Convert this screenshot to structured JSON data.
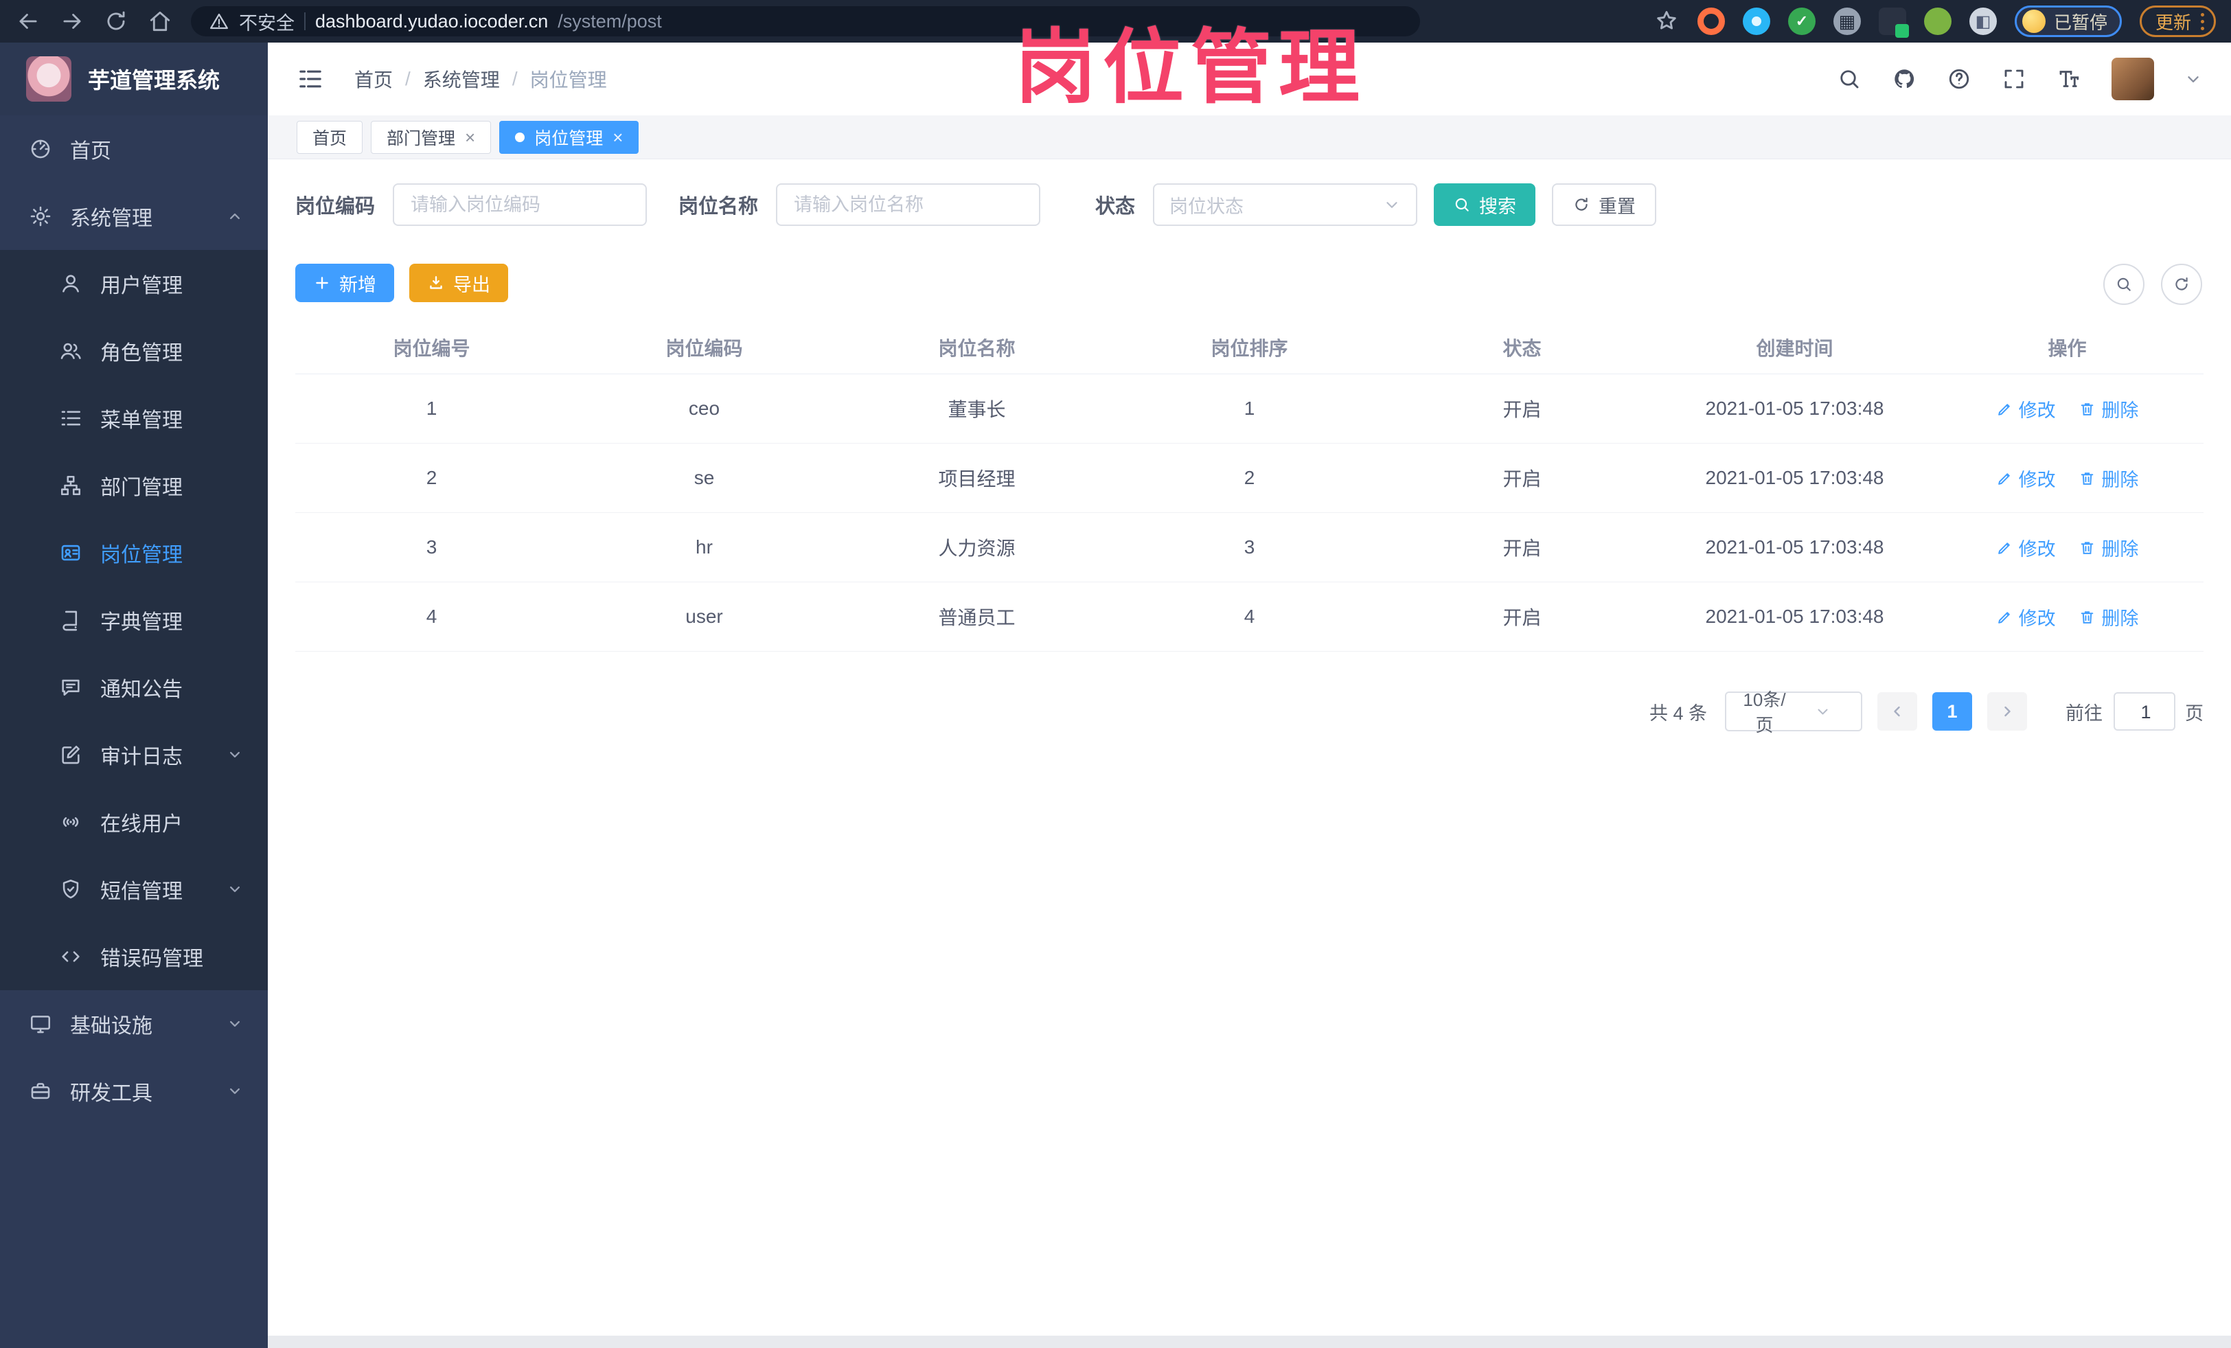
{
  "colors": {
    "accent": "#409eff",
    "search_button": "#2ab9ae",
    "export_button": "#efa41d",
    "annotation": "#f4426a",
    "sidebar_bg": "#2e3a56",
    "submenu_bg": "#242f42"
  },
  "annotation": {
    "title": "岗位管理"
  },
  "browser": {
    "security_label": "不安全",
    "url_domain": "dashboard.yudao.iocoder.cn",
    "url_path": "/system/post",
    "profile_badge": "已暂停",
    "update_label": "更新"
  },
  "app": {
    "logo_title": "芋道管理系统",
    "breadcrumb": [
      "首页",
      "系统管理",
      "岗位管理"
    ]
  },
  "tabs": [
    {
      "label": "首页"
    },
    {
      "label": "部门管理"
    },
    {
      "label": "岗位管理"
    }
  ],
  "sidebar": {
    "items": [
      {
        "label": "首页",
        "icon": "dashboard-icon"
      },
      {
        "label": "系统管理",
        "icon": "gear-icon"
      },
      {
        "label": "用户管理",
        "icon": "user-icon"
      },
      {
        "label": "角色管理",
        "icon": "users-icon"
      },
      {
        "label": "菜单管理",
        "icon": "menu-list-icon"
      },
      {
        "label": "部门管理",
        "icon": "org-tree-icon"
      },
      {
        "label": "岗位管理",
        "icon": "id-card-icon"
      },
      {
        "label": "字典管理",
        "icon": "book-icon"
      },
      {
        "label": "通知公告",
        "icon": "announcement-icon"
      },
      {
        "label": "审计日志",
        "icon": "edit-square-icon"
      },
      {
        "label": "在线用户",
        "icon": "online-signal-icon"
      },
      {
        "label": "短信管理",
        "icon": "shield-icon"
      },
      {
        "label": "错误码管理",
        "icon": "code-icon"
      },
      {
        "label": "基础设施",
        "icon": "monitor-icon"
      },
      {
        "label": "研发工具",
        "icon": "toolbox-icon"
      }
    ]
  },
  "filters": {
    "code_label": "岗位编码",
    "code_placeholder": "请输入岗位编码",
    "name_label": "岗位名称",
    "name_placeholder": "请输入岗位名称",
    "status_label": "状态",
    "status_placeholder": "岗位状态",
    "search_label": "搜索",
    "reset_label": "重置"
  },
  "toolbar": {
    "add_label": "新增",
    "export_label": "导出"
  },
  "table": {
    "headers": [
      "岗位编号",
      "岗位编码",
      "岗位名称",
      "岗位排序",
      "状态",
      "创建时间",
      "操作"
    ],
    "actions": {
      "edit": "修改",
      "delete": "删除"
    },
    "rows": [
      {
        "id": "1",
        "code": "ceo",
        "name": "董事长",
        "sort": "1",
        "status": "开启",
        "created": "2021-01-05 17:03:48"
      },
      {
        "id": "2",
        "code": "se",
        "name": "项目经理",
        "sort": "2",
        "status": "开启",
        "created": "2021-01-05 17:03:48"
      },
      {
        "id": "3",
        "code": "hr",
        "name": "人力资源",
        "sort": "3",
        "status": "开启",
        "created": "2021-01-05 17:03:48"
      },
      {
        "id": "4",
        "code": "user",
        "name": "普通员工",
        "sort": "4",
        "status": "开启",
        "created": "2021-01-05 17:03:48"
      }
    ]
  },
  "pagination": {
    "total": "共 4 条",
    "page_size": "10条/页",
    "page": "1",
    "goto_label": "前往",
    "goto_value": "1",
    "unit_label": "页"
  }
}
